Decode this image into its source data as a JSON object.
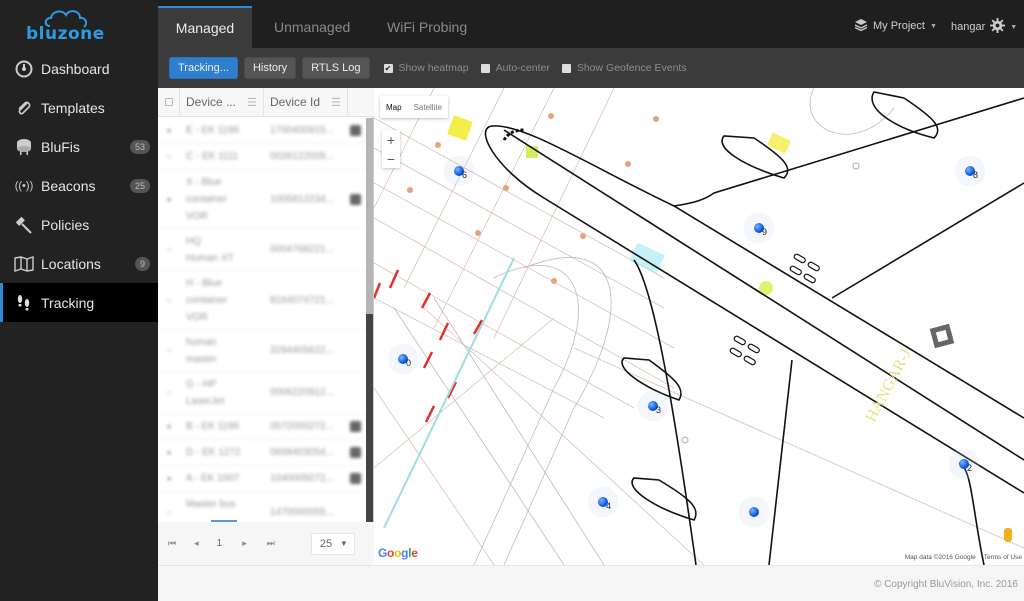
{
  "brand": {
    "name": "bluzone",
    "color": "#2e9be0"
  },
  "sidebar": {
    "items": [
      {
        "label": "Dashboard",
        "icon": "dashboard-icon",
        "badge": null
      },
      {
        "label": "Templates",
        "icon": "paperclip-icon",
        "badge": null
      },
      {
        "label": "BluFis",
        "icon": "blufi-icon",
        "badge": "53"
      },
      {
        "label": "Beacons",
        "icon": "beacon-icon",
        "badge": "25"
      },
      {
        "label": "Policies",
        "icon": "gavel-icon",
        "badge": null
      },
      {
        "label": "Locations",
        "icon": "map-icon",
        "badge": "9"
      },
      {
        "label": "Tracking",
        "icon": "footprints-icon",
        "badge": null,
        "active": true
      }
    ]
  },
  "topbar": {
    "tabs": [
      {
        "label": "Managed",
        "active": true
      },
      {
        "label": "Unmanaged"
      },
      {
        "label": "WiFi Probing"
      }
    ],
    "project": "My Project",
    "user": "hangar"
  },
  "toolbar": {
    "tracking_label": "Tracking...",
    "history_label": "History",
    "rtls_label": "RTLS Log",
    "show_heatmap": {
      "label": "Show heatmap",
      "checked": true
    },
    "auto_center": {
      "label": "Auto-center",
      "checked": false
    },
    "geofence": {
      "label": "Show Geofence Events",
      "checked": false
    }
  },
  "table": {
    "columns": [
      "Device ...",
      "Device Id"
    ],
    "rows": [
      {
        "name": [
          "E - EK 1196"
        ],
        "id": "1700400915...",
        "tag": true
      },
      {
        "name": [
          "C - EK 1111"
        ],
        "id": "0026122009...",
        "tag": false
      },
      {
        "name": [
          "X - Blue",
          "container",
          "VOR"
        ],
        "id": "1005812234...",
        "tag": true
      },
      {
        "name": [
          "HQ",
          "Human XT"
        ],
        "id": "0004768221...",
        "tag": false
      },
      {
        "name": [
          "H - Blue",
          "container",
          "VOR"
        ],
        "id": "8164074721...",
        "tag": false
      },
      {
        "name": [
          "human",
          "master"
        ],
        "id": "3294405622...",
        "tag": false
      },
      {
        "name": [
          "G - HP",
          "LaserJet"
        ],
        "id": "0006220912...",
        "tag": false
      },
      {
        "name": [
          "B - EK 1196"
        ],
        "id": "0572000272...",
        "tag": true
      },
      {
        "name": [
          "D - EK 1272"
        ],
        "id": "0668403054...",
        "tag": true
      },
      {
        "name": [
          "A - EK 1007"
        ],
        "id": "1040005072...",
        "tag": true
      },
      {
        "name": [
          "Master bus",
          "..."
        ],
        "id": "1470000055...",
        "tag": false
      }
    ],
    "pager": {
      "page": "1",
      "page_size": "25"
    }
  },
  "map": {
    "type_options": [
      "Map",
      "Satellite"
    ],
    "selected_type": "Map",
    "zoom_in": "+",
    "zoom_out": "−",
    "hangar_label": "HANGAR-J",
    "pins": [
      {
        "label": "6"
      },
      {
        "label": "8"
      },
      {
        "label": "9"
      },
      {
        "label": "0"
      },
      {
        "label": "3"
      },
      {
        "label": "4"
      },
      {
        "label": "2"
      },
      {
        "label": ""
      }
    ],
    "attribution": "Map data ©2016 Google",
    "terms": "Terms of Use",
    "google_logo": "Google"
  },
  "footer": {
    "copyright": "© Copyright BluVision, Inc. 2016"
  }
}
